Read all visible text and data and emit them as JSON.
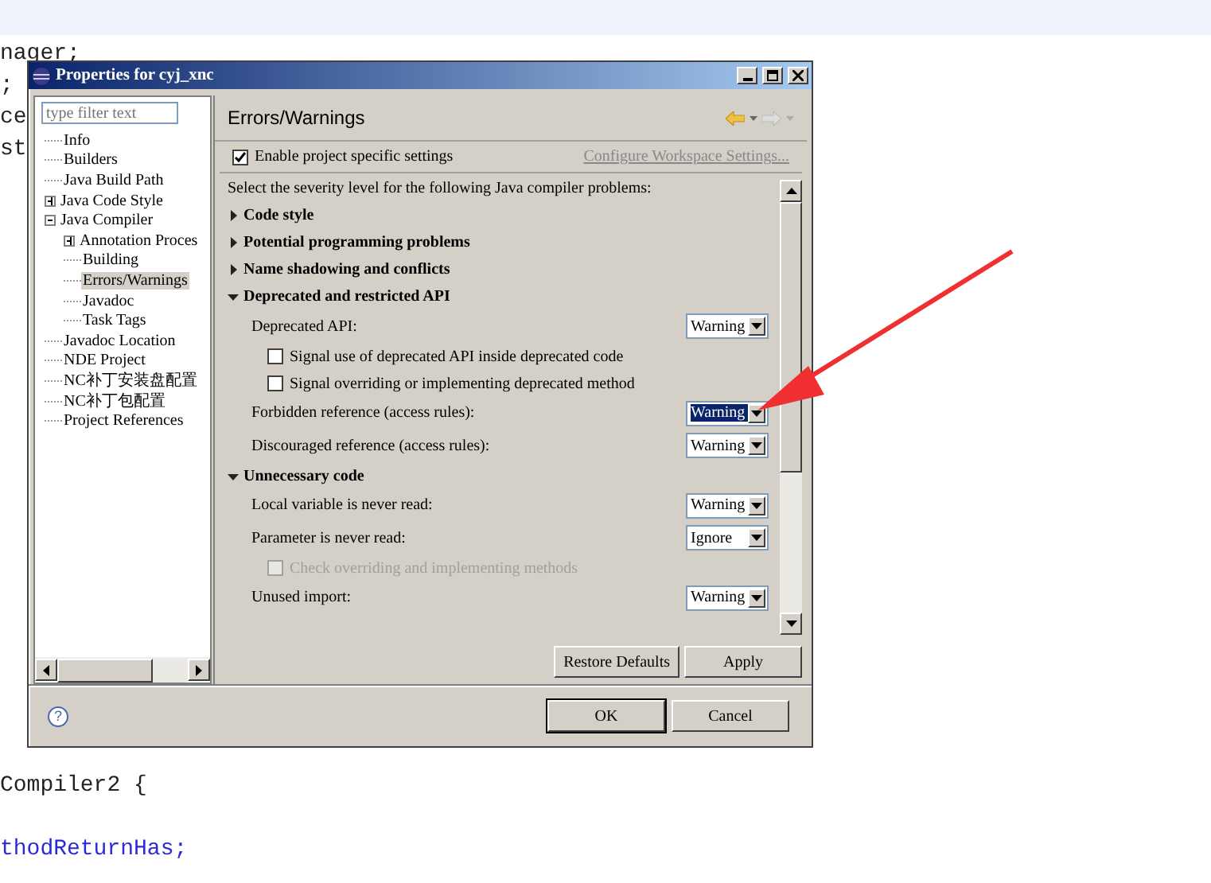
{
  "editor": {
    "lines_above": [
      "nager;",
      ";",
      "ce",
      "st"
    ],
    "lines_below": [
      {
        "text": "Compiler2 {",
        "kind": "plain"
      },
      {
        "text": "thodReturnHas;",
        "kind": "field"
      }
    ]
  },
  "dialog": {
    "title": "Properties for cyj_xnc",
    "filter": {
      "placeholder": "type filter text"
    },
    "tree": [
      {
        "label": "Info",
        "selected": false
      },
      {
        "label": "Builders",
        "selected": false
      },
      {
        "label": "Java Build Path",
        "selected": false
      },
      {
        "label": "Java Code Style",
        "selected": false,
        "expanded": false
      },
      {
        "label": "Java Compiler",
        "selected": false,
        "expanded": true,
        "children": [
          {
            "label": "Annotation Proces",
            "selected": false,
            "expanded": false
          },
          {
            "label": "Building",
            "selected": false
          },
          {
            "label": "Errors/Warnings",
            "selected": true
          },
          {
            "label": "Javadoc",
            "selected": false
          },
          {
            "label": "Task Tags",
            "selected": false
          }
        ]
      },
      {
        "label": "Javadoc Location",
        "selected": false
      },
      {
        "label": "NDE Project",
        "selected": false
      },
      {
        "label": "NC补丁安装盘配置",
        "selected": false
      },
      {
        "label": "NC补丁包配置",
        "selected": false
      },
      {
        "label": "Project References",
        "selected": false
      }
    ],
    "page_title": "Errors/Warnings",
    "enable": {
      "label": "Enable project specific settings",
      "checked": true
    },
    "workspace_link": "Configure Workspace Settings...",
    "intro": "Select the severity level for the following Java compiler problems:",
    "sections": [
      {
        "title": "Code style",
        "expanded": false
      },
      {
        "title": "Potential programming problems",
        "expanded": false
      },
      {
        "title": "Name shadowing and conflicts",
        "expanded": false
      },
      {
        "title": "Deprecated and restricted API",
        "expanded": true,
        "items": [
          {
            "kind": "combo",
            "label": "Deprecated API:",
            "value": "Warning",
            "focused": false
          },
          {
            "kind": "checkbox",
            "label": "Signal use of deprecated API inside deprecated code",
            "checked": false,
            "disabled": false
          },
          {
            "kind": "checkbox",
            "label": "Signal overriding or implementing deprecated method",
            "checked": false,
            "disabled": false
          },
          {
            "kind": "combo",
            "label": "Forbidden reference (access rules):",
            "value": "Warning",
            "focused": true
          },
          {
            "kind": "combo",
            "label": "Discouraged reference (access rules):",
            "value": "Warning",
            "focused": false
          }
        ]
      },
      {
        "title": "Unnecessary code",
        "expanded": true,
        "items": [
          {
            "kind": "combo",
            "label": "Local variable is never read:",
            "value": "Warning",
            "focused": false
          },
          {
            "kind": "combo",
            "label": "Parameter is never read:",
            "value": "Ignore",
            "focused": false
          },
          {
            "kind": "checkbox",
            "label": "Check overriding and implementing methods",
            "checked": false,
            "disabled": true
          },
          {
            "kind": "combo",
            "label": "Unused import:",
            "value": "Warning",
            "focused": false
          }
        ]
      }
    ],
    "page_buttons": [
      "Restore Defaults",
      "Apply"
    ],
    "help": "?",
    "buttons": [
      {
        "label": "OK",
        "default": true
      },
      {
        "label": "Cancel",
        "default": false
      }
    ]
  }
}
